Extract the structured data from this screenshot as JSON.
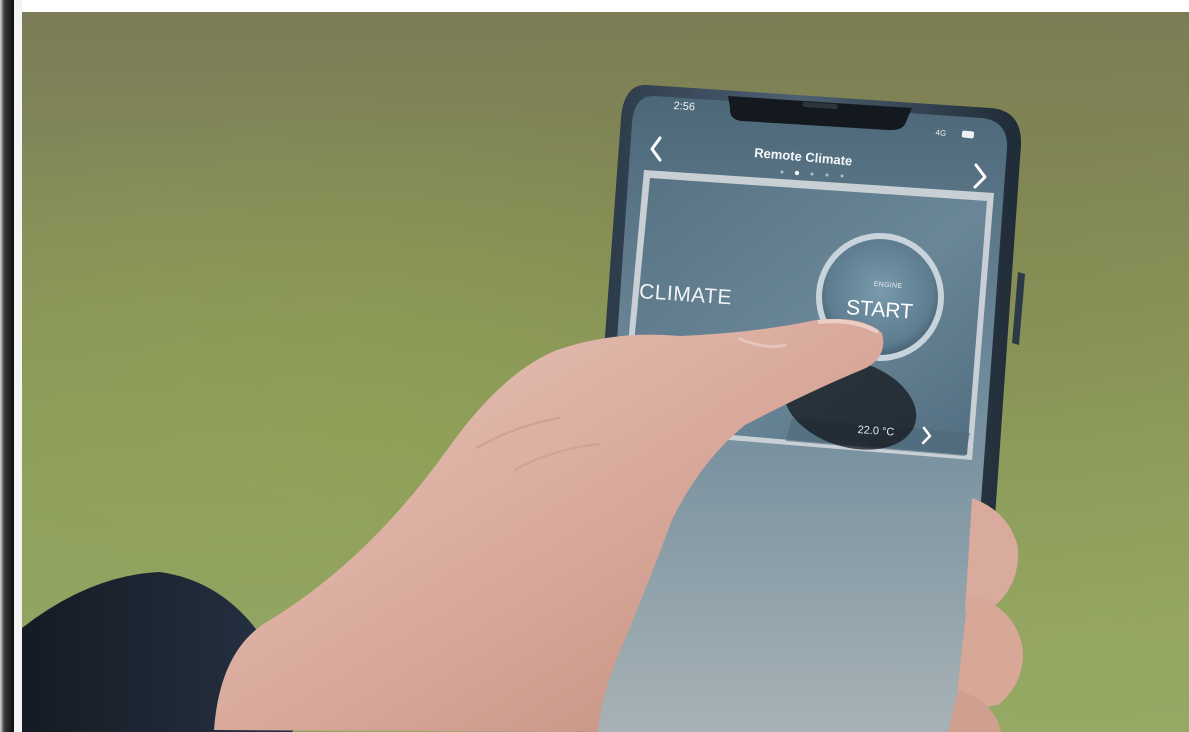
{
  "phone": {
    "status_time": "2:56",
    "status_right": "4G",
    "title": "Remote Climate"
  },
  "panel": {
    "climate_label": "CLIMATE",
    "engine_label": "ENGINE",
    "start_label": "START",
    "temperature": "22.0 °C"
  },
  "icons": {
    "back": "chevron-left-icon",
    "forward": "chevron-right-icon",
    "temperature_arrow": "chevron-right-icon"
  },
  "colors": {
    "grass": "#8ea05f",
    "phone_frame": "#3c4d5d",
    "screen_blue": "#587586",
    "skin": "#dcaea0"
  }
}
